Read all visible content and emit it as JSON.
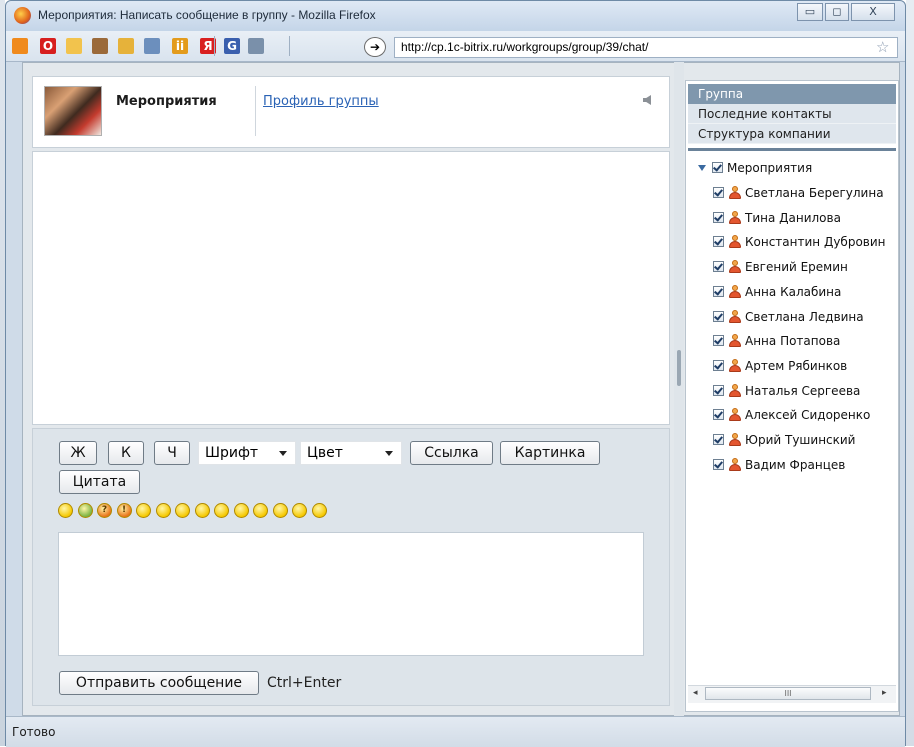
{
  "window": {
    "title": "Мероприятия: Написать сообщение в группу - Mozilla Firefox",
    "minimize_glyph": "▭",
    "maximize_glyph": "◻",
    "close_glyph": "X"
  },
  "toolbar": {
    "url": "http://cp.1c-bitrix.ru/workgroups/group/39/chat/",
    "go_glyph": "➔",
    "bookmark_glyph": "☆",
    "icons": [
      {
        "name": "rss-icon",
        "glyph": "",
        "color": "#f08a1c"
      },
      {
        "name": "opera-icon",
        "glyph": "O",
        "color": "#d71f1f"
      },
      {
        "name": "folder-icon",
        "glyph": "",
        "color": "#f2c34d"
      },
      {
        "name": "tag-icon",
        "glyph": "",
        "color": "#9b6a3a"
      },
      {
        "name": "chart-icon",
        "glyph": "",
        "color": "#e6b23a"
      },
      {
        "name": "page-icon",
        "glyph": "",
        "color": "#6c8fbd"
      },
      {
        "name": "people-icon",
        "glyph": "ii",
        "color": "#e39b1c"
      },
      {
        "name": "yandex-icon",
        "glyph": "Я",
        "color": "#d92020"
      },
      {
        "name": "google-icon",
        "glyph": "G",
        "color": "#3a5fae"
      },
      {
        "name": "calendar-icon",
        "glyph": "",
        "color": "#7a90aa"
      }
    ]
  },
  "group": {
    "name": "Мероприятия",
    "profile_link": "Профиль группы"
  },
  "composer": {
    "bold": "Ж",
    "italic": "К",
    "underline": "Ч",
    "font_select": "Шрифт",
    "color_select": "Цвет",
    "link_button": "Ссылка",
    "image_button": "Картинка",
    "quote_button": "Цитата",
    "send_button": "Отправить сообщение",
    "shortcut_hint": "Ctrl+Enter",
    "smileys": [
      {
        "name": "laugh-smiley-icon",
        "glyph": "",
        "bg": "#f5c800"
      },
      {
        "name": "sync-smiley-icon",
        "glyph": "",
        "bg": "#7bb342"
      },
      {
        "name": "question-smiley-icon",
        "glyph": "?",
        "bg": "#e8731a"
      },
      {
        "name": "exclamation-smiley-icon",
        "glyph": "!",
        "bg": "#e8731a"
      },
      {
        "name": "smile-icon",
        "glyph": "",
        "bg": "#f5c800"
      },
      {
        "name": "sad-smiley-icon",
        "glyph": "",
        "bg": "#f5c800"
      },
      {
        "name": "frown-smiley-icon",
        "glyph": "",
        "bg": "#f5c800"
      },
      {
        "name": "cry-smiley-icon",
        "glyph": "",
        "bg": "#f5c800"
      },
      {
        "name": "kiss-smiley-icon",
        "glyph": "",
        "bg": "#f5c800"
      },
      {
        "name": "cool-smiley-icon",
        "glyph": "",
        "bg": "#f5c800"
      },
      {
        "name": "surprised-smiley-icon",
        "glyph": "",
        "bg": "#f5c800"
      },
      {
        "name": "angry-smiley-icon",
        "glyph": "",
        "bg": "#f5c800"
      },
      {
        "name": "happy-smiley-icon",
        "glyph": "",
        "bg": "#f5c800"
      },
      {
        "name": "neutral-smiley-icon",
        "glyph": "",
        "bg": "#f5c800"
      }
    ]
  },
  "sidebar": {
    "tabs": [
      {
        "label": "Группа",
        "active": true
      },
      {
        "label": "Последние контакты",
        "active": false
      },
      {
        "label": "Структура компании",
        "active": false
      }
    ],
    "root": "Мероприятия",
    "members": [
      "Светлана Берегулина",
      "Тина Данилова",
      "Константин Дубровин",
      "Евгений Еремин",
      "Анна Калабина",
      "Светлана Ледвина",
      "Анна Потапова",
      "Артем Рябинков",
      "Наталья Сергеева",
      "Алексей Сидоренко",
      "Юрий Тушинский",
      "Вадим Францев"
    ],
    "scroll_left": "◂",
    "scroll_right": "▸",
    "scroll_grip": "III"
  },
  "status": {
    "text": "Готово"
  }
}
